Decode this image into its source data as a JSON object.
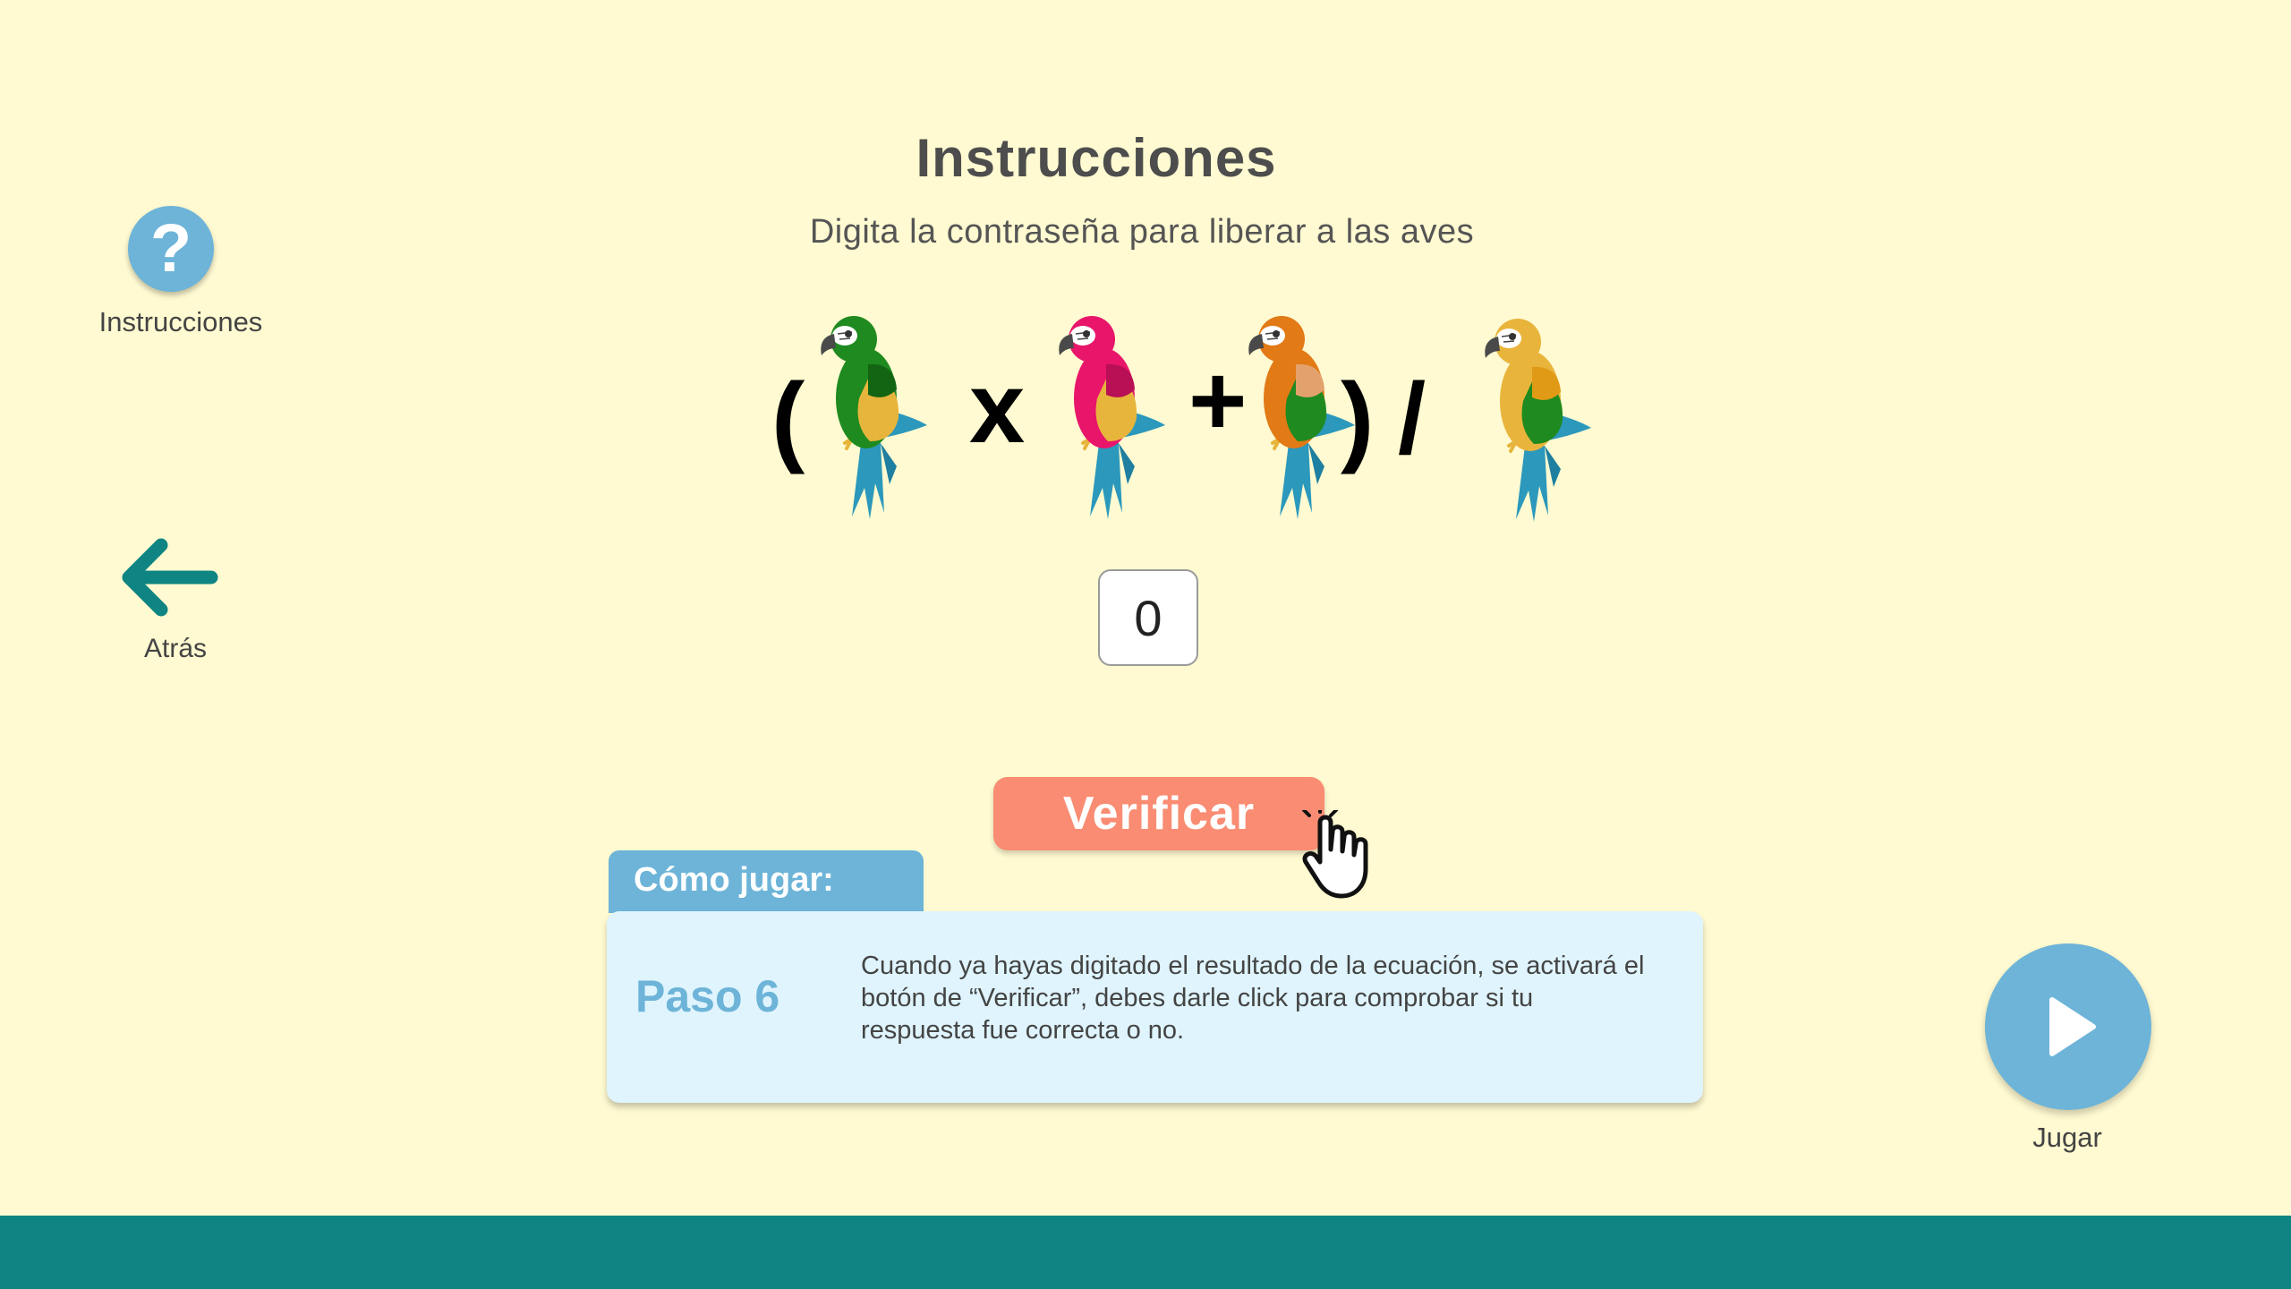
{
  "header": {
    "title": "Instrucciones",
    "subtitle": "Digita la contraseña para liberar a las aves"
  },
  "left_nav": {
    "help_label": "Instrucciones",
    "help_glyph": "?",
    "back_label": "Atrás"
  },
  "equation": {
    "open_paren": "(",
    "times": "x",
    "plus": "+",
    "close_paren": ")",
    "divide": "/",
    "birds": [
      {
        "name": "green-parrot-icon",
        "body": "#1f8a1f",
        "wing": "#e7b53c",
        "head": "#1f8a1f",
        "shoulder": "#136513"
      },
      {
        "name": "pink-parrot-icon",
        "body": "#e8156b",
        "wing": "#e7b53c",
        "head": "#e8156b",
        "shoulder": "#b80f55"
      },
      {
        "name": "orange-parrot-icon",
        "body": "#e27a16",
        "wing": "#1f8a1f",
        "head": "#e27a16",
        "shoulder": "#e3a26d"
      },
      {
        "name": "yellow-parrot-icon",
        "body": "#e9b43b",
        "wing": "#1f8a1f",
        "head": "#e9b43b",
        "shoulder": "#e09a15"
      }
    ]
  },
  "answer": {
    "value": "0"
  },
  "verify": {
    "label": "Verificar"
  },
  "howto": {
    "tab_label": "Cómo jugar:",
    "step_label": "Paso 6",
    "step_text": "Cuando ya hayas digitado el resultado de la ecuación, se activará el botón de “Verificar”, debes darle click para comprobar si tu respuesta fue correcta o no."
  },
  "play": {
    "label": "Jugar"
  },
  "colors": {
    "background": "#fffad1",
    "accent_blue": "#6db4d8",
    "verify_orange": "#f98c72",
    "teal": "#0e8582",
    "card_bg": "#dff4fd"
  }
}
